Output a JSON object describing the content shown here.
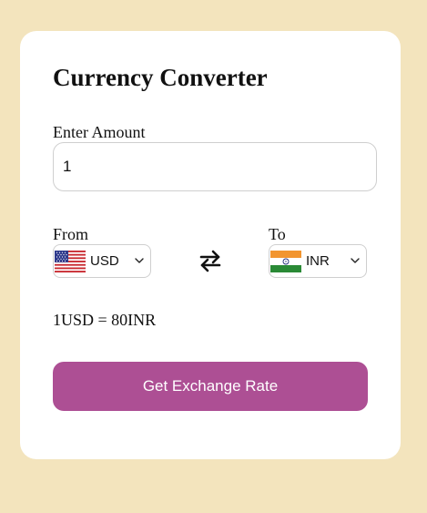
{
  "converter": {
    "title": "Currency Converter",
    "amount_label": "Enter Amount",
    "amount_value": "1",
    "from_label": "From",
    "to_label": "To",
    "from_currency": {
      "code": "USD",
      "flag_icon": "us-flag-icon"
    },
    "to_currency": {
      "code": "INR",
      "flag_icon": "india-flag-icon"
    },
    "swap_icon": "swap-arrows-icon",
    "rate_text": "1USD = 80INR",
    "button_label": "Get Exchange Rate"
  },
  "colors": {
    "page_background": "#f3e4bd",
    "card_background": "#ffffff",
    "button_background": "#ad4f94",
    "button_text": "#ffffff"
  }
}
